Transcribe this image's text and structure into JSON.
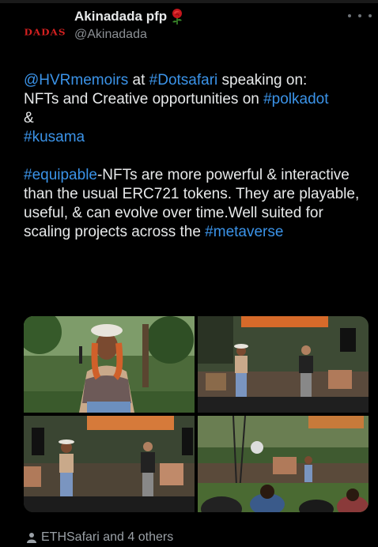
{
  "author": {
    "display_name": "Akinadada pfp",
    "handle": "@Akinadada",
    "avatar_text": "DADAS"
  },
  "tweet": {
    "line1": [
      "@HVRmemoirs",
      " at ",
      "#Dotsafari",
      " speaking on:"
    ],
    "line2": [
      "NFTs and Creative opportunities on ",
      "#polkadot"
    ],
    "line3": "&",
    "line4": "#kusama",
    "para2_start": "#equipable",
    "para2_text": "-NFTs are more powerful  & interactive than the usual ERC721 tokens. They are playable, useful, & can evolve over time.Well suited for scaling projects across the ",
    "para2_end": "#metaverse"
  },
  "media": {
    "photos": [
      "speaker-closeup",
      "stage-wide-1",
      "stage-wide-2",
      "audience-view"
    ]
  },
  "footer": {
    "liked_by": "ETHSafari and 4 others"
  },
  "icons": {
    "rose": "rose-icon",
    "more": "more-icon",
    "person": "person-icon"
  },
  "colors": {
    "background": "#000000",
    "text": "#e7e9ea",
    "link": "#3b93e8",
    "muted": "#8b8f94"
  }
}
